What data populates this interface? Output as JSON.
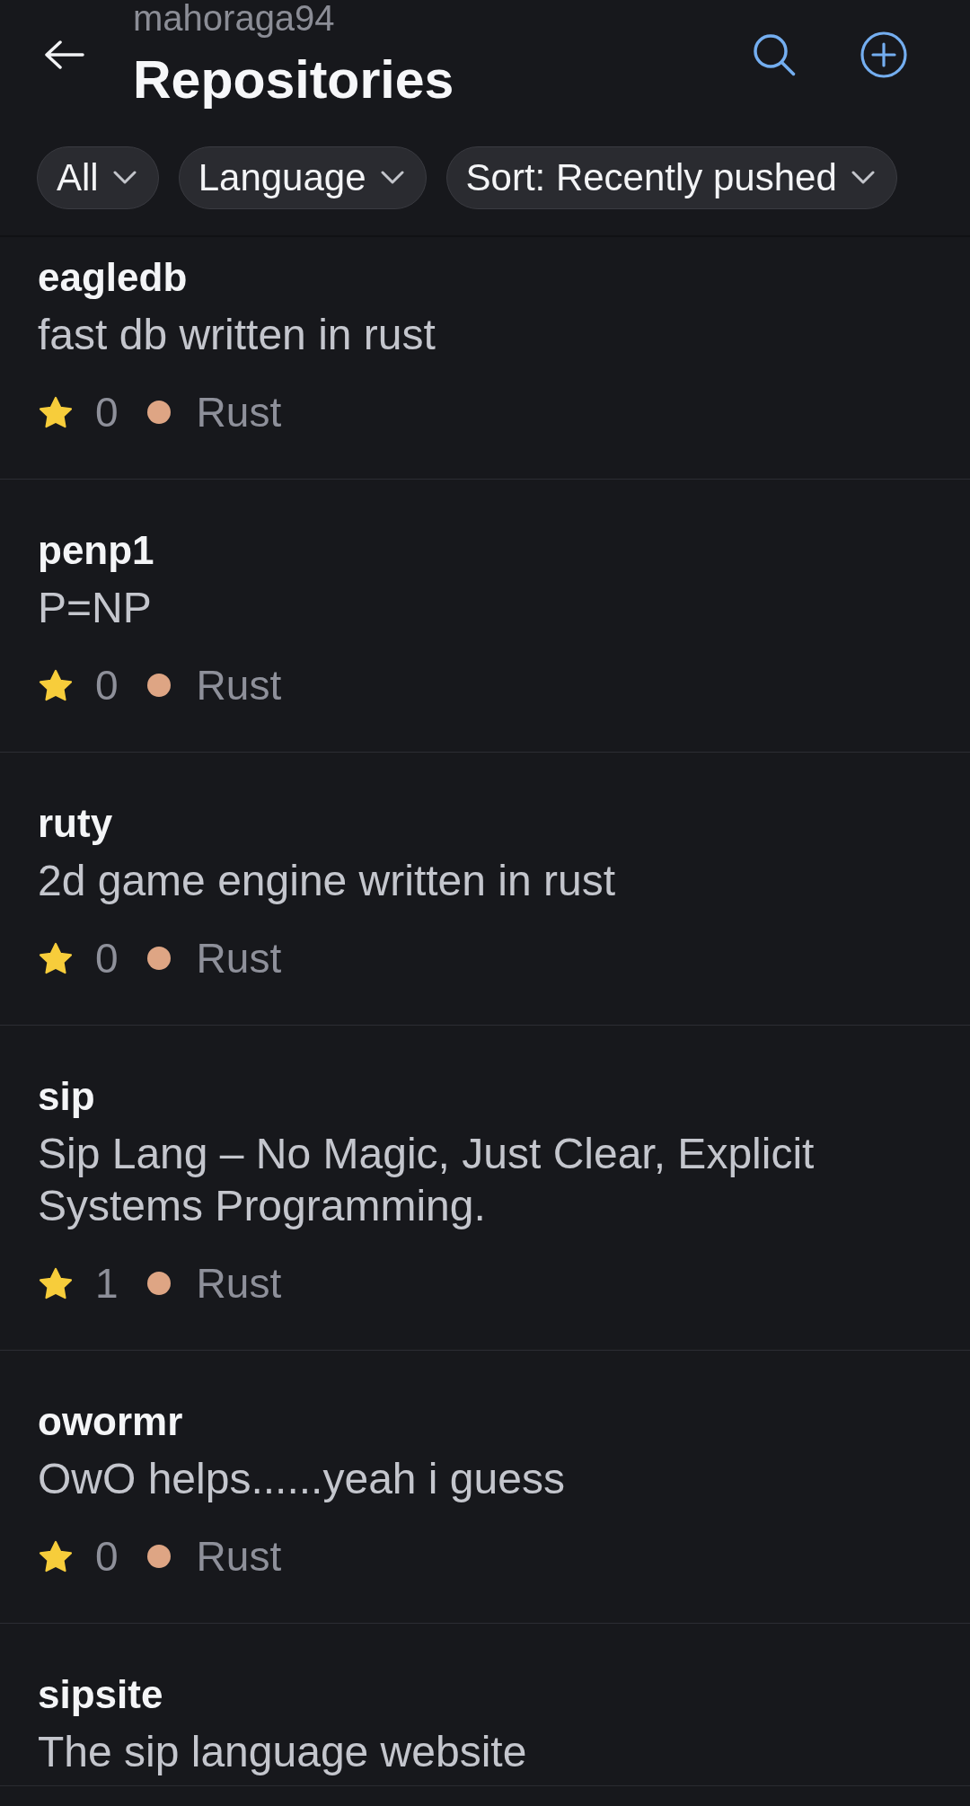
{
  "header": {
    "owner": "mahoraga94",
    "title": "Repositories"
  },
  "filters": [
    {
      "label": "All"
    },
    {
      "label": "Language"
    },
    {
      "label": "Sort: Recently pushed"
    }
  ],
  "repositories": [
    {
      "name": "eagledb",
      "description": "fast db written in rust",
      "star_count": "0",
      "language": {
        "name": "Rust",
        "color": "#dea584"
      }
    },
    {
      "name": "penp1",
      "description": "P=NP",
      "star_count": "0",
      "language": {
        "name": "Rust",
        "color": "#dea584"
      }
    },
    {
      "name": "ruty",
      "description": "2d game engine written in rust",
      "star_count": "0",
      "language": {
        "name": "Rust",
        "color": "#dea584"
      }
    },
    {
      "name": "sip",
      "description": "Sip Lang – No Magic, Just Clear, Explicit Systems Programming.",
      "star_count": "1",
      "language": {
        "name": "Rust",
        "color": "#dea584"
      }
    },
    {
      "name": "owormr",
      "description": "OwO helps......yeah i guess",
      "star_count": "0",
      "language": {
        "name": "Rust",
        "color": "#dea584"
      }
    },
    {
      "name": "sipsite",
      "description": "The sip language website"
    }
  ]
}
